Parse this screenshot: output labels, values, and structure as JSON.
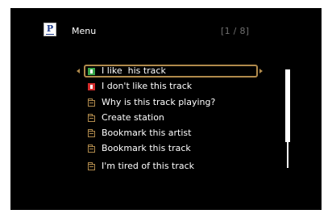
{
  "header": {
    "logo_letter": "P",
    "title": "Menu",
    "page_indicator": "[1 / 8]"
  },
  "menu": {
    "items": [
      {
        "label": "I like  his track",
        "icon": "thumbs-up-icon",
        "selected": true
      },
      {
        "label": "I don't like this track",
        "icon": "thumbs-down-icon",
        "selected": false
      },
      {
        "label": "Why is this track playing?",
        "icon": "folder-icon",
        "selected": false
      },
      {
        "label": "Create station",
        "icon": "folder-icon",
        "selected": false
      },
      {
        "label": "Bookmark this artist",
        "icon": "folder-icon",
        "selected": false
      },
      {
        "label": "Bookmark this track",
        "icon": "folder-icon",
        "selected": false
      },
      {
        "label": "I'm tired of this track",
        "icon": "folder-icon",
        "selected": false
      }
    ]
  },
  "scrollbar": {
    "position_fraction": 0.0,
    "visible_fraction": 0.74
  },
  "colors": {
    "background": "#000000",
    "text": "#ffffff",
    "accent": "#b08a4c",
    "thumbs_up": "#39a64a",
    "thumbs_down": "#d42b2b",
    "page_indicator": "#6f6f6f"
  }
}
